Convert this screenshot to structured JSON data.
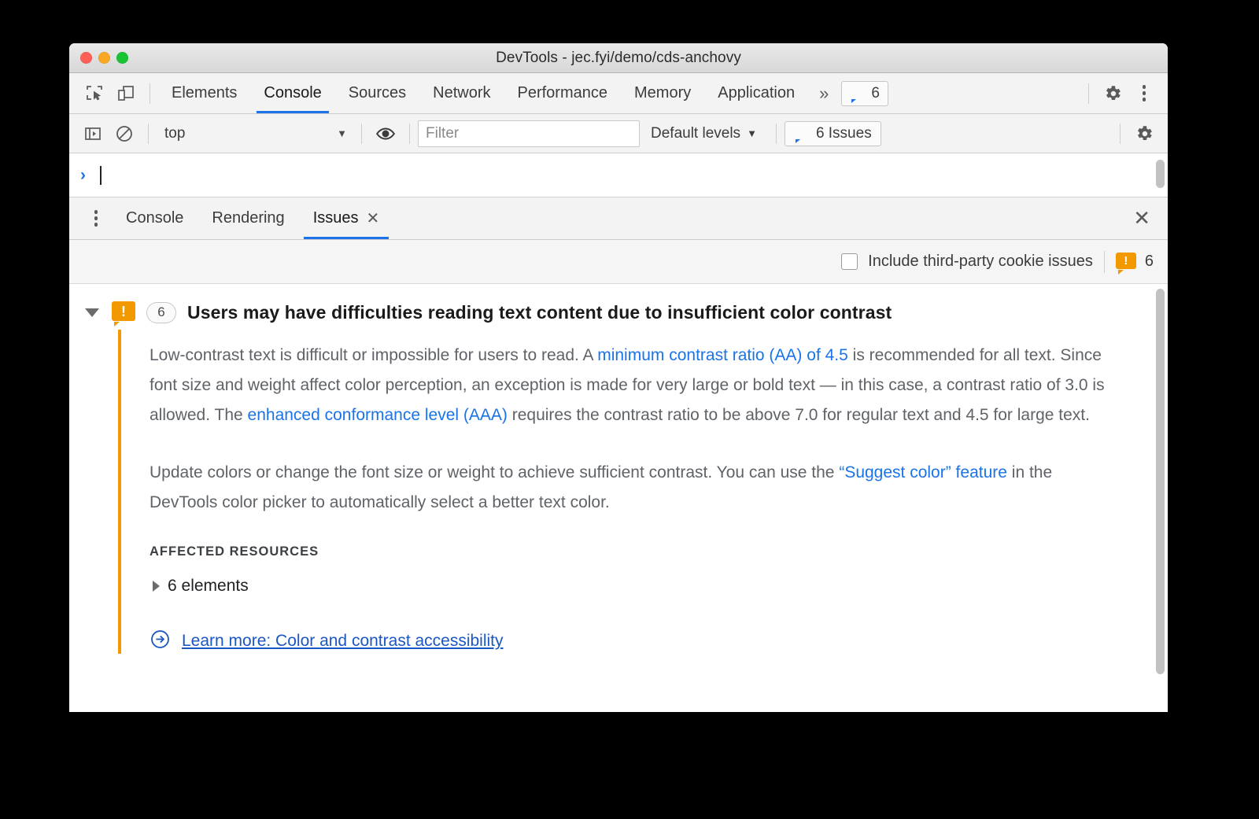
{
  "window": {
    "title": "DevTools - jec.fyi/demo/cds-anchovy"
  },
  "main_tabs": {
    "items": [
      {
        "label": "Elements",
        "active": false
      },
      {
        "label": "Console",
        "active": true
      },
      {
        "label": "Sources",
        "active": false
      },
      {
        "label": "Network",
        "active": false
      },
      {
        "label": "Performance",
        "active": false
      },
      {
        "label": "Memory",
        "active": false
      },
      {
        "label": "Application",
        "active": false
      }
    ],
    "overflow_label": "»",
    "issues_badge_count": "6"
  },
  "console_toolbar": {
    "context": "top",
    "context_caret": "▼",
    "filter_placeholder": "Filter",
    "levels_label": "Default levels",
    "levels_caret": "▼",
    "issues_button_label": "6 Issues"
  },
  "console_prompt": {
    "chevron": "›"
  },
  "drawer": {
    "tabs": [
      {
        "label": "Console",
        "active": false,
        "closable": false
      },
      {
        "label": "Rendering",
        "active": false,
        "closable": false
      },
      {
        "label": "Issues",
        "active": true,
        "closable": true
      }
    ],
    "close_label": "✕",
    "tab_close_glyph": "✕"
  },
  "issues_filter": {
    "checkbox_label": "Include third-party cookie issues",
    "warning_count": "6"
  },
  "issue": {
    "count": "6",
    "title": "Users may have difficulties reading text content due to insufficient color contrast",
    "warning_glyph": "!",
    "paragraph1": {
      "part1": "Low-contrast text is difficult or impossible for users to read. A ",
      "link1": "minimum contrast ratio (AA) of 4.5",
      "part2": " is recommended for all text. Since font size and weight affect color perception, an exception is made for very large or bold text — in this case, a contrast ratio of 3.0 is allowed. The ",
      "link2": "enhanced conformance level (AAA)",
      "part3": " requires the contrast ratio to be above 7.0 for regular text and 4.5 for large text."
    },
    "paragraph2": {
      "part1": "Update colors or change the font size or weight to achieve sufficient contrast. You can use the ",
      "link1": "“Suggest color” feature",
      "part2": " in the DevTools color picker to automatically select a better text color."
    },
    "affected_resources_label": "AFFECTED RESOURCES",
    "affected_resources_value": "6 elements",
    "learn_more_label": "Learn more: Color and contrast accessibility"
  },
  "colors": {
    "accent_blue": "#1a73e8",
    "warning_orange": "#f29900",
    "link_blue": "#1a73e8",
    "learn_more_blue": "#1a56c4",
    "body_text": "#5f6368"
  }
}
